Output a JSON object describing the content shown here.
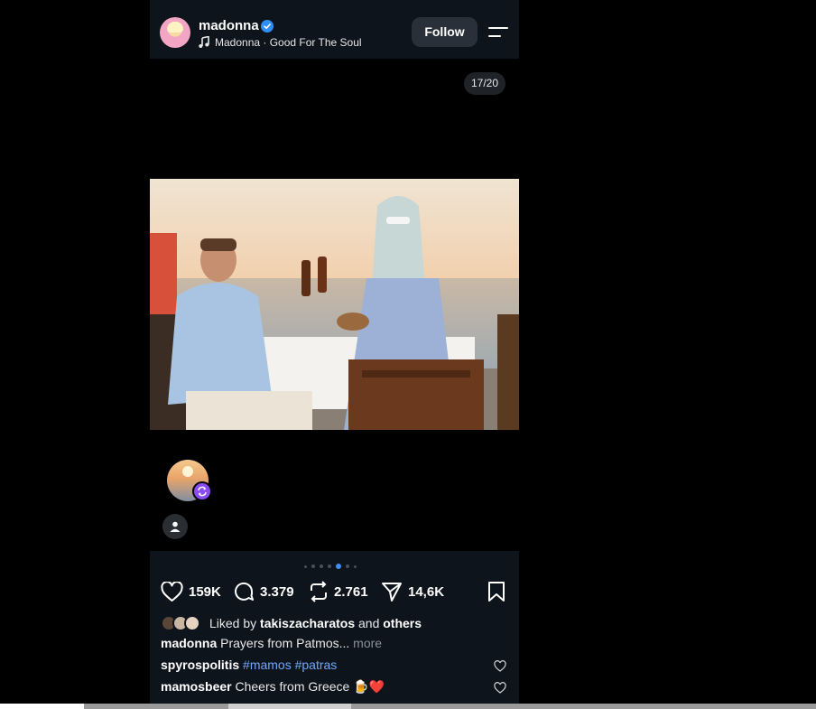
{
  "header": {
    "username": "madonna",
    "verified": true,
    "song": "Madonna · Good For The Soul",
    "follow_label": "Follow"
  },
  "media": {
    "counter": "17/20",
    "carousel_dots": 7,
    "active_dot": 5
  },
  "actions": {
    "likes": "159K",
    "comments": "3.379",
    "reposts": "2.761",
    "shares": "14,6K"
  },
  "liked_by": {
    "prefix": "Liked by",
    "user": "takiszacharatos",
    "and": "and",
    "others": "others"
  },
  "caption": {
    "user": "madonna",
    "text": "Prayers from Patmos...",
    "more": "more"
  },
  "comments": [
    {
      "user": "spyrospolitis",
      "text": "#mamos #patras"
    },
    {
      "user": "mamosbeer",
      "text": "Cheers from Greece 🍺❤️"
    }
  ],
  "colors": {
    "header_bg": "#0e141b",
    "accent_blue": "#3e8ef7",
    "repost_purple": "#8b4cf7",
    "hashtag": "#6ea8fe"
  },
  "icons": [
    "verified-badge-icon",
    "music-note-icon",
    "menu-icon",
    "heart-icon",
    "comment-icon",
    "repost-icon",
    "share-icon",
    "bookmark-icon",
    "user-tag-icon"
  ]
}
